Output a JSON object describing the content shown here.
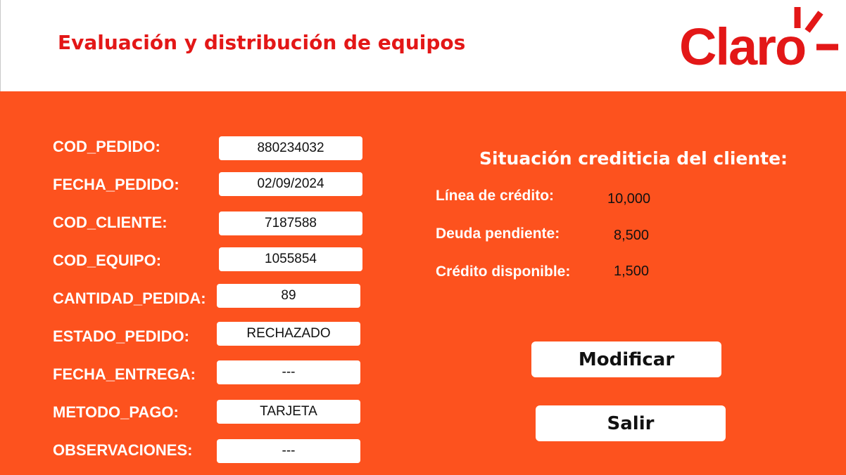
{
  "header": {
    "title": "Evaluación y distribución de equipos",
    "logo_text": "Claro",
    "brand_color": "#e31717"
  },
  "form": {
    "cod_pedido": {
      "label": "COD_PEDIDO:",
      "value": "880234032"
    },
    "fecha_pedido": {
      "label": "FECHA_PEDIDO:",
      "value": "02/09/2024"
    },
    "cod_cliente": {
      "label": "COD_CLIENTE:",
      "value": "7187588"
    },
    "cod_equipo": {
      "label": "COD_EQUIPO:",
      "value": "1055854"
    },
    "cantidad_pedida": {
      "label": "CANTIDAD_PEDIDA:",
      "value": "89"
    },
    "estado_pedido": {
      "label": "ESTADO_PEDIDO:",
      "value": "RECHAZADO"
    },
    "fecha_entrega": {
      "label": "FECHA_ENTREGA:",
      "value": "---"
    },
    "metodo_pago": {
      "label": "METODO_PAGO:",
      "value": "TARJETA"
    },
    "observaciones": {
      "label": "OBSERVACIONES:",
      "value": "---"
    }
  },
  "credit": {
    "title": "Situación crediticia del cliente:",
    "linea_label": "Línea de crédito:",
    "linea_value": "10,000",
    "deuda_label": "Deuda pendiente:",
    "deuda_value": "8,500",
    "disponible_label": "Crédito disponible:",
    "disponible_value": "1,500"
  },
  "actions": {
    "modify_label": "Modificar",
    "exit_label": "Salir"
  },
  "colors": {
    "panel_background": "#fd521e",
    "title_red": "#e31717"
  },
  "icons": {
    "logo": "claro-logo"
  }
}
